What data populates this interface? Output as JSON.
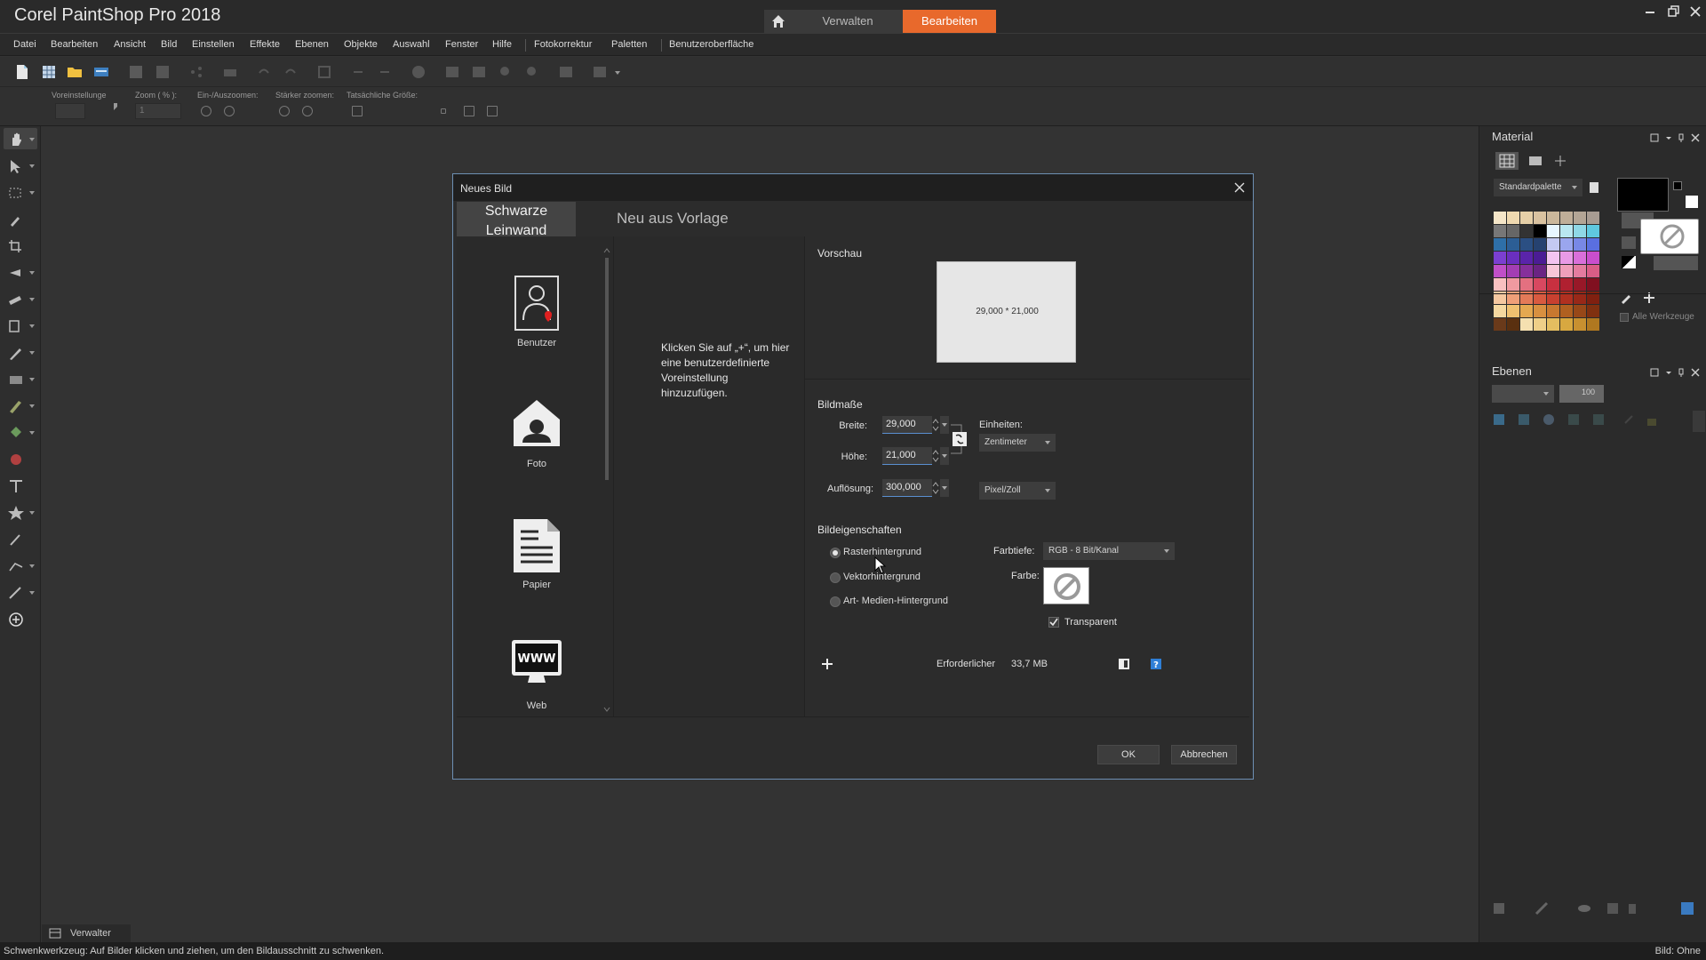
{
  "app": {
    "title": "Corel PaintShop Pro 2018",
    "tabs": [
      {
        "label": "Verwalten",
        "active": false
      },
      {
        "label": "Bearbeiten",
        "active": true
      }
    ]
  },
  "menu": [
    "Datei",
    "Bearbeiten",
    "Ansicht",
    "Bild",
    "Einstellen",
    "Effekte",
    "Ebenen",
    "Objekte",
    "Auswahl",
    "Fenster",
    "Hilfe",
    "Fotokorrektur",
    "Paletten",
    "Benutzeroberfläche"
  ],
  "tool_options": {
    "preset_label": "Voreinstellunge",
    "zoom_label": "Zoom ( % ):",
    "zoom_value": "1",
    "zoom_inout_label": "Ein-/Auszoomen:",
    "zoom_more_label": "Stärker zoomen:",
    "actual_size_label": "Tatsächliche Größe:"
  },
  "right_panel": {
    "material_title": "Material",
    "palette_select": "Standardpalette",
    "all_tools_label": "Alle Werkzeuge",
    "layers_title": "Ebenen",
    "layers_opacity": "100"
  },
  "bottom": {
    "organizer_tab": "Verwalter",
    "status_text": "Schwenkwerkzeug: Auf Bilder klicken und ziehen, um den Bildausschnitt zu schwenken.",
    "status_right": "Bild: Ohne"
  },
  "dialog": {
    "title": "Neues Bild",
    "tab_active_line1": "Schwarze",
    "tab_active_line2": "Leinwand",
    "tab_inactive": "Neu aus Vorlage",
    "presets": [
      "Benutzer",
      "Foto",
      "Papier",
      "Web"
    ],
    "preset_description": "Klicken Sie auf „+“, um hier eine benutzerdefinierte Voreinstellung hinzuzufügen.",
    "preview_title": "Vorschau",
    "preview_size": "29,000 * 21,000",
    "dimensions_title": "Bildmaße",
    "width_label": "Breite:",
    "width_value": "29,000",
    "height_label": "Höhe:",
    "height_value": "21,000",
    "resolution_label": "Auflösung:",
    "resolution_value": "300,000",
    "units_label": "Einheiten:",
    "units_value": "Zentimeter",
    "resolution_unit": "Pixel/Zoll",
    "properties_title": "Bildeigenschaften",
    "bg_options": [
      "Rasterhintergrund",
      "Vektorhintergrund",
      "Art- Medien-Hintergrund"
    ],
    "bg_selected": 0,
    "depth_label": "Farbtiefe:",
    "depth_value": "RGB - 8 Bit/Kanal",
    "color_label": "Farbe:",
    "transparent_label": "Transparent",
    "transparent_checked": true,
    "memory_label": "Erforderlicher",
    "memory_value": "33,7 MB",
    "ok_label": "OK",
    "cancel_label": "Abbrechen"
  }
}
